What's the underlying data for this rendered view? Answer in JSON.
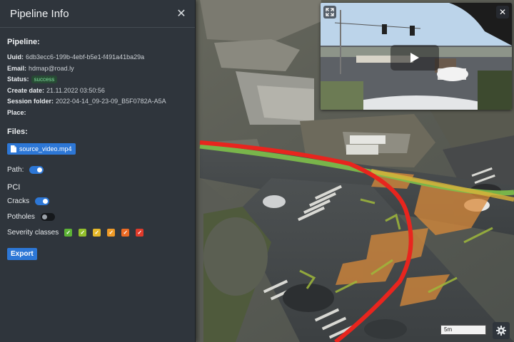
{
  "panel": {
    "title": "Pipeline Info",
    "pipeline_heading": "Pipeline:",
    "fields": [
      {
        "label": "Uuid:",
        "value": "6db3ecc6-199b-4ebf-b5e1-f491a41ba29a"
      },
      {
        "label": "Email:",
        "value": "hdmap@road.ly"
      },
      {
        "label": "Status:",
        "value": "success"
      },
      {
        "label": "Create date:",
        "value": "21.11.2022 03:50:56"
      },
      {
        "label": "Session folder:",
        "value": "2022-04-14_09-23-09_B5F0782A-A5A"
      },
      {
        "label": "Place:",
        "value": ""
      }
    ],
    "files_heading": "Files:",
    "file_name": "source_video.mp4",
    "path_label": "Path:",
    "path_enabled": true,
    "pci_heading": "PCI",
    "cracks_label": "Cracks",
    "cracks_enabled": true,
    "potholes_label": "Potholes",
    "potholes_enabled": false,
    "severity_label": "Severity classes",
    "severity_colors": [
      "#5cb335",
      "#93bf2b",
      "#e5b82a",
      "#ef9a26",
      "#ec6a24",
      "#e03a2a"
    ],
    "export_label": "Export"
  },
  "map": {
    "scale_label": "5m",
    "path_colors": {
      "primary": "#e8251e",
      "secondary": "#7ec04a"
    }
  },
  "video": {
    "icons": [
      "expand-icon",
      "close-icon",
      "play-icon"
    ]
  }
}
